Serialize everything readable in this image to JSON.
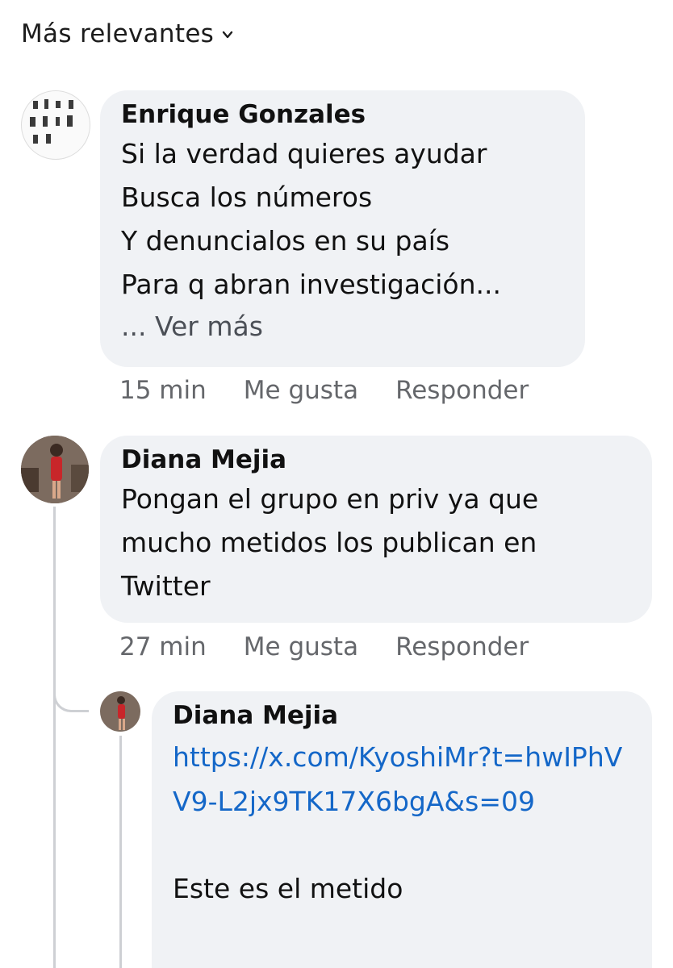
{
  "sort": {
    "label": "Más relevantes",
    "icon": "chevron-down-icon"
  },
  "comments": [
    {
      "author": "Enrique Gonzales",
      "text": "Si la verdad quieres  ayudar\nBusca los números\nY denuncialos en su país\nPara q abran investigación...",
      "see_more": "... Ver más",
      "time": "15 min",
      "like_label": "Me gusta",
      "reply_label": "Responder"
    },
    {
      "author": "Diana Mejia",
      "text": "Pongan el grupo en priv ya que\nmucho metidos los publican en\nTwitter",
      "time": "27 min",
      "like_label": "Me gusta",
      "reply_label": "Responder",
      "replies": [
        {
          "author": "Diana Mejia",
          "link": "https://x.com/KyoshiMr?t=hwIPhVV9-L2jx9TK17X6bgA&s=09",
          "text": "Este es el metido"
        }
      ]
    }
  ],
  "colors": {
    "bubble": "#f0f2f5",
    "link": "#1467c8",
    "meta": "#65676b",
    "thread": "#ced0d4"
  }
}
